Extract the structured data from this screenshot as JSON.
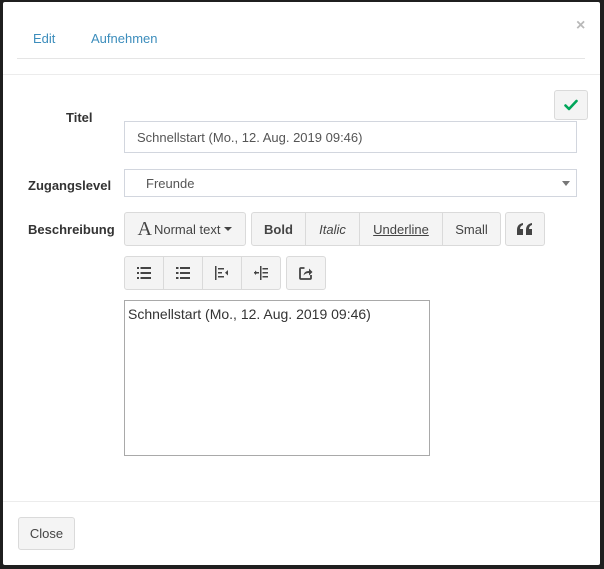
{
  "tabs": [
    {
      "label": "Edit"
    },
    {
      "label": "Aufnehmen"
    }
  ],
  "close_symbol": "×",
  "form": {
    "title_label": "Titel",
    "title_value": "Schnellstart (Mo., 12. Aug. 2019 09:46)",
    "access_label": "Zugangslevel",
    "access_value": "Freunde",
    "description_label": "Beschreibung",
    "description_text": "Schnellstart (Mo., 12. Aug. 2019 09:46)"
  },
  "toolbar": {
    "font_glyph": "A",
    "font_label": "Normal text",
    "bold": "Bold",
    "italic": "Italic",
    "underline": "Underline",
    "small": "Small",
    "quote_icon": "quote-icon",
    "list_icons": [
      "unordered-list-icon",
      "ordered-list-icon",
      "outdent-icon",
      "indent-icon"
    ],
    "link_icon": "share-icon"
  },
  "footer": {
    "close_label": "Close"
  },
  "colors": {
    "tab_link": "#3c8dbc",
    "check": "#00a65a",
    "button_bg": "#f4f4f4"
  }
}
